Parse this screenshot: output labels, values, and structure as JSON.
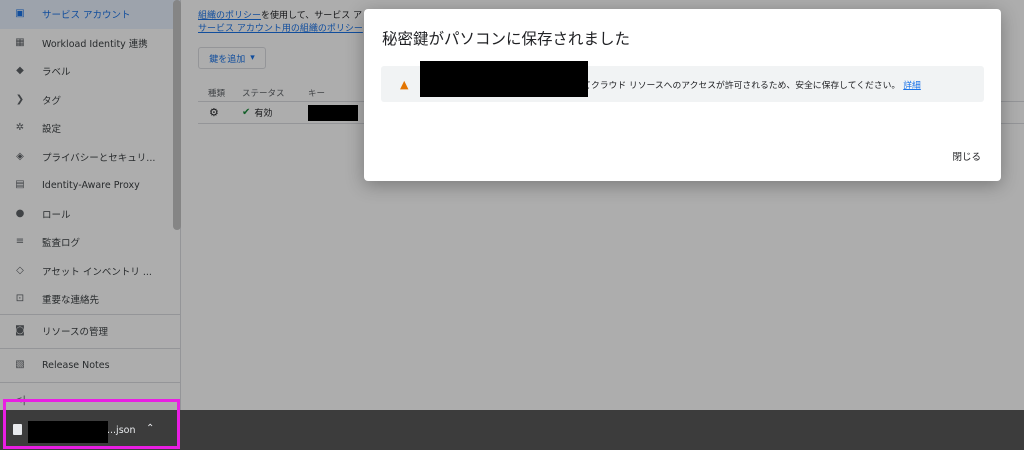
{
  "sidebar": {
    "items": [
      {
        "label": "サービス アカウント",
        "icon": "service-account-icon"
      },
      {
        "label": "Workload Identity 連携",
        "icon": "workload-icon"
      },
      {
        "label": "ラベル",
        "icon": "label-icon"
      },
      {
        "label": "タグ",
        "icon": "tag-icon"
      },
      {
        "label": "設定",
        "icon": "gear-icon"
      },
      {
        "label": "プライバシーとセキュリ...",
        "icon": "shield-icon"
      },
      {
        "label": "Identity-Aware Proxy",
        "icon": "proxy-icon"
      },
      {
        "label": "ロール",
        "icon": "role-icon"
      },
      {
        "label": "監査ログ",
        "icon": "list-icon"
      },
      {
        "label": "アセット インベントリ ...",
        "icon": "asset-icon"
      },
      {
        "label": "重要な連絡先",
        "icon": "contacts-icon"
      },
      {
        "label": "リソースの管理",
        "icon": "resource-icon"
      },
      {
        "label": "Release Notes",
        "icon": "notes-icon"
      }
    ],
    "collapse_label": "<|"
  },
  "main": {
    "policy_link": "組織のポリシー",
    "policy_text": "を使用して、サービス ア",
    "policy_link2": "サービス アカウント用の組織のポリシー",
    "add_key_label": "鍵を追加",
    "table_headers": [
      "種類",
      "ステータス",
      "キー"
    ],
    "row_status": "有効"
  },
  "dialog": {
    "title": "秘密鍵がパソコンに保存されました",
    "warning_text": "によってクラウド リソースへのアクセスが許可されるため、安全に保存してください。",
    "details_link": "詳細",
    "close_label": "閉じる"
  },
  "download": {
    "file_suffix": "...json"
  }
}
